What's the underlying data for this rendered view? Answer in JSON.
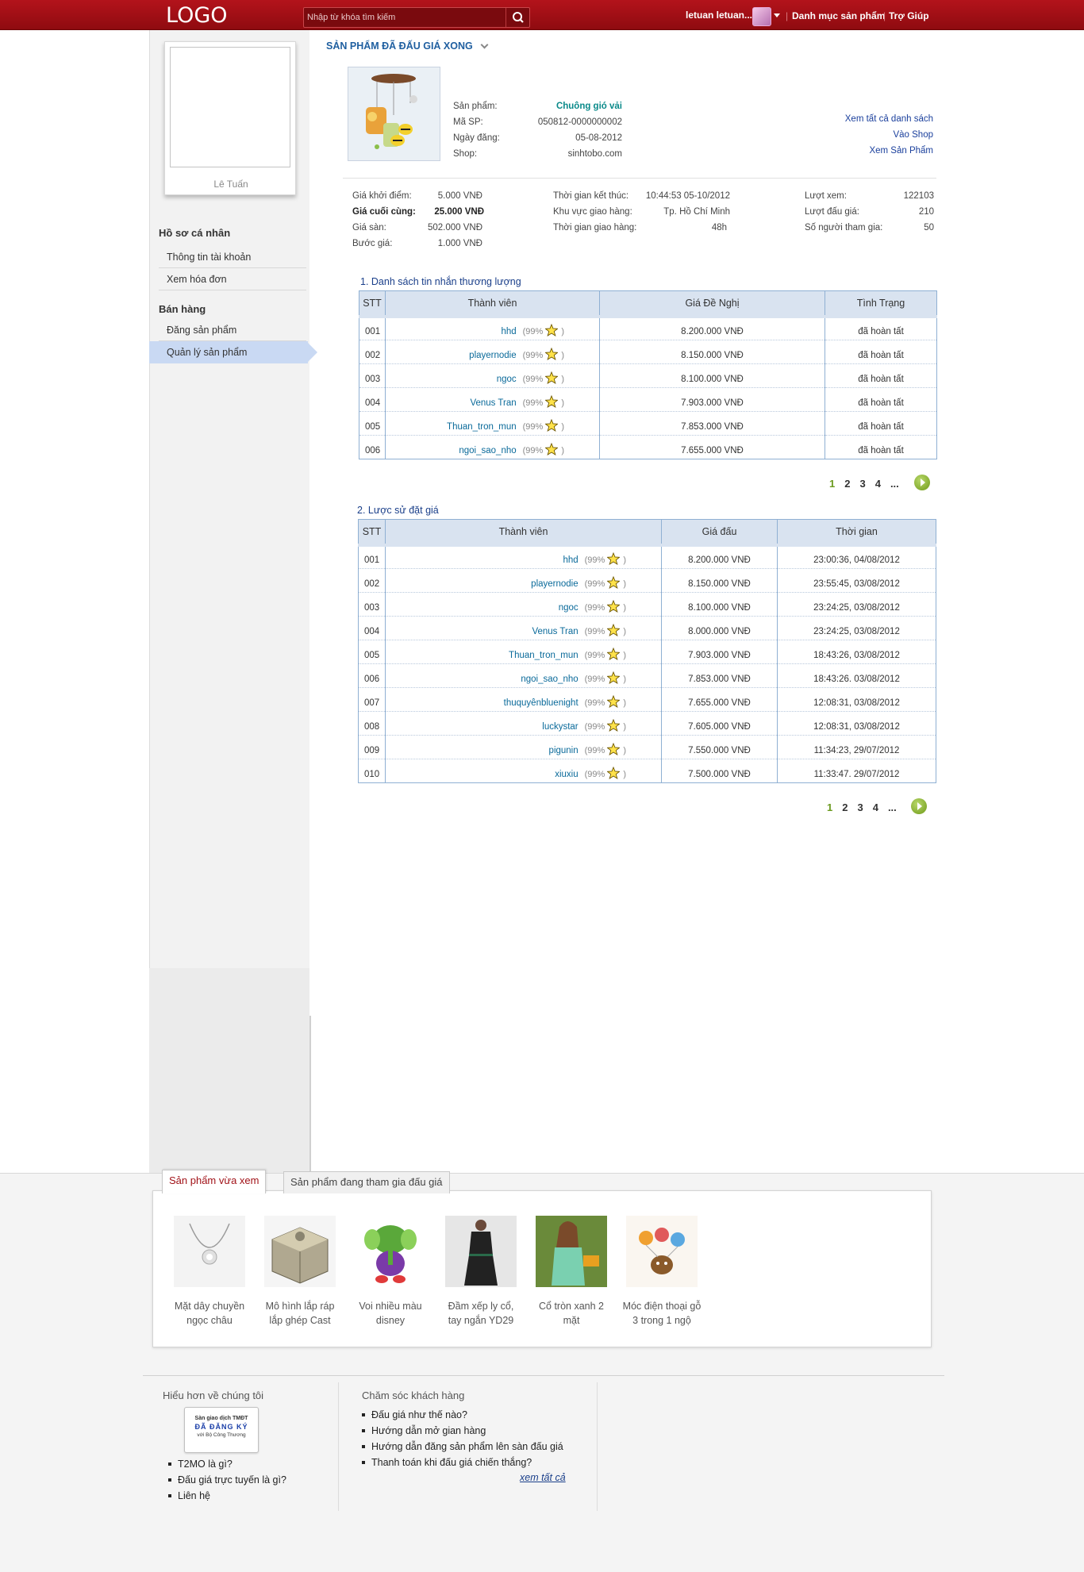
{
  "header": {
    "logo": "LOGO",
    "search_placeholder": "Nhập từ khóa tìm kiếm",
    "user": "letuan letuan...",
    "nav": [
      "Danh mục sản phẩm",
      "Trợ Giúp"
    ]
  },
  "sidebar": {
    "profile_name": "Lê Tuấn",
    "group1": "Hồ sơ cá nhân",
    "group1_items": [
      "Thông tin tài khoản",
      "Xem hóa đơn"
    ],
    "group2": "Bán hàng",
    "group2_items": [
      "Đăng sản phẩm",
      "Quản lý sản phẩm"
    ],
    "active_item": "Quản lý sản phẩm"
  },
  "main": {
    "title": "SẢN PHẨM ĐÃ ĐẤU GIÁ XONG",
    "product": {
      "labels": [
        "Sản phẩm:",
        "Mã SP:",
        "Ngày đăng:",
        "Shop:"
      ],
      "name": "Chuông gió vải",
      "code": "050812-0000000002",
      "date": "05-08-2012",
      "shop": "sinhtobo.com"
    },
    "links": [
      "Xem tất cả danh sách",
      "Vào Shop",
      "Xem Sản Phẩm"
    ],
    "stats": {
      "col1": [
        {
          "label": "Giá khởi điểm:",
          "value": "5.000 VNĐ"
        },
        {
          "label": "Giá cuối cùng:",
          "value": "25.000 VNĐ"
        },
        {
          "label": "Giá sàn:",
          "value": "502.000 VNĐ"
        },
        {
          "label": "Bước giá:",
          "value": "1.000 VNĐ"
        }
      ],
      "col2": [
        {
          "label": "Thời gian kết thúc:",
          "value": "10:44:53 05-10/2012"
        },
        {
          "label": "Khu vực giao hàng:",
          "value": "Tp. Hồ Chí Minh"
        },
        {
          "label": "Thời gian giao hàng:",
          "value": "48h"
        }
      ],
      "col3": [
        {
          "label": "Lượt xem:",
          "value": "122103"
        },
        {
          "label": "Lượt đấu giá:",
          "value": "210"
        },
        {
          "label": "Số người tham gia:",
          "value": "50"
        }
      ]
    },
    "negotiation": {
      "title": "1. Danh sách tin nhắn thương lượng",
      "headers": [
        "STT",
        "Thành viên",
        "Giá Đề Nghị",
        "Tình Trạng"
      ],
      "rows": [
        {
          "stt": "001",
          "member": "hhd",
          "pct": "(99%",
          "price": "8.200.000 VNĐ",
          "status": "đã hoàn tất"
        },
        {
          "stt": "002",
          "member": "playernodie",
          "pct": "(99%",
          "price": "8.150.000 VNĐ",
          "status": "đã hoàn tất"
        },
        {
          "stt": "003",
          "member": "ngoc",
          "pct": "(99%",
          "price": "8.100.000 VNĐ",
          "status": "đã hoàn tất"
        },
        {
          "stt": "004",
          "member": "Venus Tran",
          "pct": "(99%",
          "price": "7.903.000 VNĐ",
          "status": "đã hoàn tất"
        },
        {
          "stt": "005",
          "member": "Thuan_tron_mun",
          "pct": "(99%",
          "price": "7.853.000 VNĐ",
          "status": "đã hoàn tất"
        },
        {
          "stt": "006",
          "member": "ngoi_sao_nho",
          "pct": "(99%",
          "price": "7.655.000 VNĐ",
          "status": "đã hoàn tất"
        }
      ],
      "pages": [
        "1",
        "2",
        "3",
        "4",
        "..."
      ]
    },
    "history": {
      "title": "2. Lược sử đặt giá",
      "headers": [
        "STT",
        "Thành viên",
        "Giá đấu",
        "Thời gian"
      ],
      "rows": [
        {
          "stt": "001",
          "member": "hhd",
          "pct": "(99%",
          "price": "8.200.000 VNĐ",
          "time": "23:00:36, 04/08/2012"
        },
        {
          "stt": "002",
          "member": "playernodie",
          "pct": "(99%",
          "price": "8.150.000 VNĐ",
          "time": "23:55:45, 03/08/2012"
        },
        {
          "stt": "003",
          "member": "ngoc",
          "pct": "(99%",
          "price": "8.100.000 VNĐ",
          "time": "23:24:25, 03/08/2012"
        },
        {
          "stt": "004",
          "member": "Venus Tran",
          "pct": "(99%",
          "price": "8.000.000 VNĐ",
          "time": "23:24:25, 03/08/2012"
        },
        {
          "stt": "005",
          "member": "Thuan_tron_mun",
          "pct": "(99%",
          "price": "7.903.000 VNĐ",
          "time": "18:43:26, 03/08/2012"
        },
        {
          "stt": "006",
          "member": "ngoi_sao_nho",
          "pct": "(99%",
          "price": "7.853.000 VNĐ",
          "time": "18:43:26. 03/08/2012"
        },
        {
          "stt": "007",
          "member": "thuquyênbluenight",
          "pct": "(99%",
          "price": "7.655.000 VNĐ",
          "time": "12:08:31, 03/08/2012"
        },
        {
          "stt": "008",
          "member": "luckystar",
          "pct": "(99%",
          "price": "7.605.000 VNĐ",
          "time": "12:08:31, 03/08/2012"
        },
        {
          "stt": "009",
          "member": "pigunin",
          "pct": "(99%",
          "price": "7.550.000 VNĐ",
          "time": "11:34:23, 29/07/2012"
        },
        {
          "stt": "010",
          "member": "xiuxiu",
          "pct": "(99%",
          "price": "7.500.000 VNĐ",
          "time": "11:33:47. 29/07/2012"
        }
      ],
      "pages": [
        "1",
        "2",
        "3",
        "4",
        "..."
      ]
    },
    "paren_close": ")"
  },
  "bottom": {
    "tabs": [
      "Sản phẩm vừa xem",
      "Sản phẩm đang tham gia đấu giá"
    ],
    "products": [
      {
        "line1": "Mặt dây chuyền",
        "line2": "ngọc châu",
        "icon": "necklace-icon"
      },
      {
        "line1": "Mô hình lắp ráp",
        "line2": "lắp ghép Cast",
        "icon": "puzzle-box-icon"
      },
      {
        "line1": "Voi nhiều màu",
        "line2": "disney",
        "icon": "elephant-toy-icon"
      },
      {
        "line1": "Đầm xếp ly cổ,",
        "line2": "tay ngắn YD29",
        "icon": "dress-icon"
      },
      {
        "line1": "Cổ tròn xanh 2",
        "line2": "mặt",
        "icon": "green-top-icon"
      },
      {
        "line1": "Móc điện thoại gỗ",
        "line2": "3 trong 1 ngộ",
        "icon": "phone-charm-icon"
      }
    ]
  },
  "footer": {
    "about_title": "Hiểu hơn về chúng tôi",
    "badge": [
      "Sàn giao dịch TMĐT",
      "ĐÃ ĐĂNG KÝ",
      "với Bộ Công Thương"
    ],
    "about_items": [
      "T2MO là gì?",
      "Đấu giá trực tuyến là gì?",
      "Liên hệ"
    ],
    "care_title": "Chăm sóc khách hàng",
    "care_items": [
      "Đấu giá như thế nào?",
      "Hướng dẫn mở gian hàng",
      "Hướng dẫn đăng sản phẩm lên sàn đấu giá",
      "Thanh toán khi đấu giá chiến thắng?"
    ],
    "see_all": "xem tất cả"
  },
  "colors": {
    "header_red": "#a3111a",
    "link_blue": "#1a3f9c",
    "teal": "#0a8a8a",
    "table_header": "#d9e3f0",
    "active_sidebar": "#c9d9f3"
  }
}
